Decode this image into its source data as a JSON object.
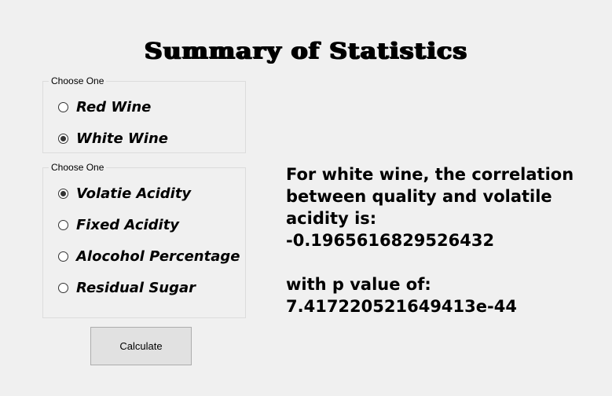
{
  "window": {
    "title": "Summary of Statistics"
  },
  "wine_group": {
    "legend": "Choose One",
    "options": [
      {
        "label": "Red Wine",
        "checked": false
      },
      {
        "label": "White Wine",
        "checked": true
      }
    ]
  },
  "measure_group": {
    "legend": "Choose One",
    "options": [
      {
        "label": "Volatie Acidity",
        "checked": true
      },
      {
        "label": "Fixed Acidity",
        "checked": false
      },
      {
        "label": "Alocohol Percentage",
        "checked": false
      },
      {
        "label": "Residual Sugar",
        "checked": false
      }
    ]
  },
  "calculate_button": {
    "label": "Calculate"
  },
  "result": {
    "line1": "For white wine, the correlation",
    "line2": "between quality and volatile",
    "line3": "acidity is:",
    "correlation": "-0.1965616829526432",
    "p_label": "with p value of:",
    "p_value": "7.417220521649413e-44"
  }
}
